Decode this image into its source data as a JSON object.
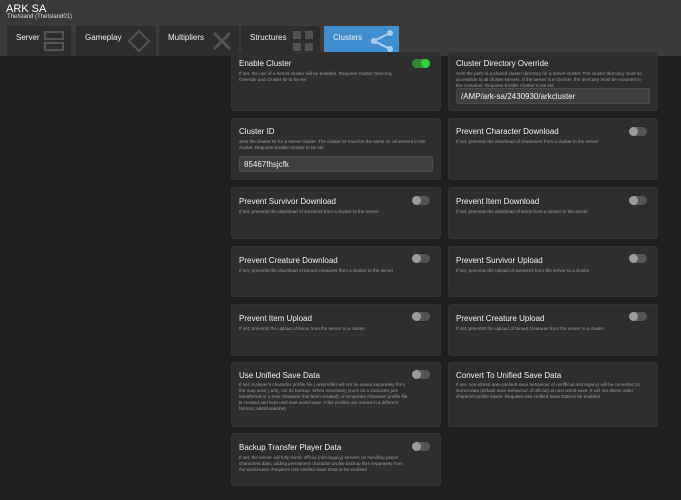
{
  "header": {
    "title": "ARK SA",
    "subtitle": "TheIsland (TheIsland01)"
  },
  "tabs": [
    {
      "label": "Server",
      "active": false
    },
    {
      "label": "Gameplay",
      "active": false
    },
    {
      "label": "Multipliers",
      "active": false
    },
    {
      "label": "Structures",
      "active": false
    },
    {
      "label": "Clusters",
      "active": true
    }
  ],
  "colors": {
    "accent": "#3f8fd0",
    "toggle_on": "#2fcf3f",
    "background": "#1f1f1f",
    "card": "#2e2e2e"
  },
  "settings": {
    "enable_cluster": {
      "title": "Enable Cluster",
      "description": "If set, the use of a server cluster will be enabled. Requires Cluster Directory Override and Cluster ID to be set",
      "enabled": true
    },
    "cluster_directory_override": {
      "title": "Cluster Directory Override",
      "description": "Sets the path to a shared cluster directory for a server cluster. The cluster directory must be accessible to all cluster servers. If the server is in Docker, the directory must be mounted in the container. Requires Enable Cluster to be set",
      "value": "/AMP/ark-sa/2430930/arkcluster"
    },
    "cluster_id": {
      "title": "Cluster ID",
      "description": "Sets the cluster ID for a server cluster. The cluster ID must be the same on all servers in the cluster. Requires Enable Cluster to be set",
      "value": "85467fhsjcfk"
    },
    "prevent_character_download": {
      "title": "Prevent Character Download",
      "description": "If set, prevents the download of characters from a cluster to the server",
      "enabled": false
    },
    "prevent_survivor_download": {
      "title": "Prevent Survivor Download",
      "description": "If set, prevents the download of survivors from a cluster to the server",
      "enabled": false
    },
    "prevent_item_download": {
      "title": "Prevent Item Download",
      "description": "If set, prevents the download of items from a cluster to the server",
      "enabled": false
    },
    "prevent_creature_download": {
      "title": "Prevent Creature Download",
      "description": "If set, prevents the download of tamed creatures from a cluster to the server",
      "enabled": false
    },
    "prevent_survivor_upload": {
      "title": "Prevent Survivor Upload",
      "description": "If set, prevents the upload of survivors from the server to a cluster",
      "enabled": false
    },
    "prevent_item_upload": {
      "title": "Prevent Item Upload",
      "description": "If set, prevents the upload of items from the server to a cluster",
      "enabled": false
    },
    "prevent_creature_upload": {
      "title": "Prevent Creature Upload",
      "description": "If set, prevents the upload of tamed creatures from the server to a cluster",
      "enabled": false
    },
    "use_unified_save_data": {
      "title": "Use Unified Save Data",
      "description": "If set, a player's character profile file (.arkprofile) will not be saved separately from the map save (.ark), nor its backup. When necessary (such as a character just transferred or a new character has been created), a temporary character profile file is created and kept until next world-save. Tribe profiles are stored in a different format (.arktributetribe)",
      "enabled": false
    },
    "convert_to_unified_save_data": {
      "title": "Convert To Unified Save Data",
      "description": "If set, non-stored data (default save behaviour of unofficial and legacy) will be converted to stored data (default save behaviour of official) at next world-save. It will not delete older character profile saves. Requires Use Unified Save Data to be enabled",
      "enabled": false
    },
    "backup_transfer_player_data": {
      "title": "Backup Transfer Player Data",
      "description": "If set, the server will fully mimic official (non-legacy) servers on handling player characters data, adding permanent character profile backup files separately from the world-save. Requires Use Unified Save Data to be enabled",
      "enabled": false
    }
  }
}
